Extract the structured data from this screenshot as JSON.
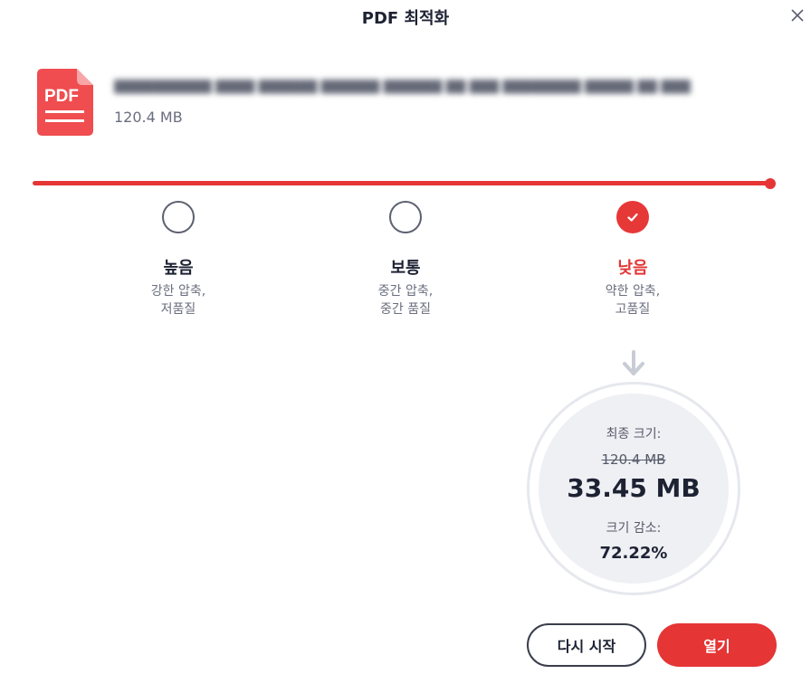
{
  "dialog": {
    "title": "PDF 최적화"
  },
  "file": {
    "icon_label": "PDF",
    "name": "██████████ ████ ██████ ██████ ██████ ██ ███ ████████ █████ ██ ███ ████████",
    "size": "120.4 MB"
  },
  "options": [
    {
      "id": "high",
      "title": "높음",
      "desc_line1": "강한 압축,",
      "desc_line2": "저품질",
      "selected": false
    },
    {
      "id": "medium",
      "title": "보통",
      "desc_line1": "중간 압축,",
      "desc_line2": "중간 품질",
      "selected": false
    },
    {
      "id": "low",
      "title": "낮음",
      "desc_line1": "약한 압축,",
      "desc_line2": "고품질",
      "selected": true
    }
  ],
  "result": {
    "final_size_label": "최종 크기:",
    "original_size": "120.4 MB",
    "final_size": "33.45 MB",
    "reduction_label": "크기 감소:",
    "reduction_value": "72.22%"
  },
  "buttons": {
    "restart": "다시 시작",
    "open": "열기"
  },
  "colors": {
    "accent": "#e53535",
    "text_dark": "#1d2233",
    "text_muted": "#6a6e7e",
    "result_bg": "#eff0f4"
  },
  "icons": [
    "pdf-file-icon",
    "close-icon",
    "checkmark-icon",
    "arrow-down-icon"
  ]
}
